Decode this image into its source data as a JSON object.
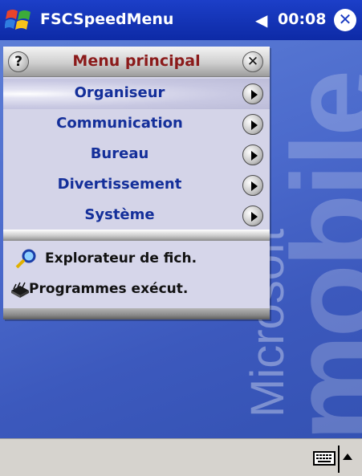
{
  "titlebar": {
    "title": "FSCSpeedMenu",
    "volume_icon": "◀€",
    "time": "00:08",
    "close": "✕"
  },
  "wallpaper": {
    "small": "Microsoft",
    "big": "mobile"
  },
  "menu": {
    "help": "?",
    "title": "Menu principal",
    "close": "✕",
    "items": [
      {
        "label": "Organiseur"
      },
      {
        "label": "Communication"
      },
      {
        "label": "Bureau"
      },
      {
        "label": "Divertissement"
      },
      {
        "label": "Système"
      }
    ],
    "apps": [
      {
        "label": "Explorateur de fich.",
        "icon": "magnifier-icon"
      },
      {
        "label": "Programmes exécut.",
        "icon": "chip-icon"
      }
    ]
  },
  "taskbar": {
    "keyboard_icon": "keyboard-icon",
    "sip_arrow": "up-arrow-icon"
  }
}
